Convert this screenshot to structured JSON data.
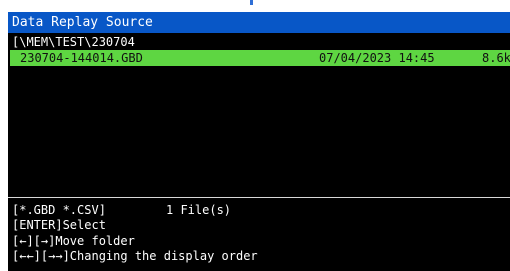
{
  "window": {
    "title": "Data Replay Source"
  },
  "path": {
    "current": "[\\MEM\\TEST\\230704"
  },
  "files": [
    {
      "name": "230704-144014.GBD",
      "date": "07/04/2023 14:45",
      "size": "8.6k"
    }
  ],
  "footer": {
    "filter": "[*.GBD *.CSV]",
    "count": "1 File(s)",
    "enter_help": "[ENTER]Select",
    "move_help": "[←][→]Move folder",
    "order_help": "[←←][→→]Changing the display order"
  },
  "colors": {
    "title_bar": "#0857c7",
    "selected_row": "#5ed642",
    "background": "#000000",
    "text": "#ffffff"
  }
}
